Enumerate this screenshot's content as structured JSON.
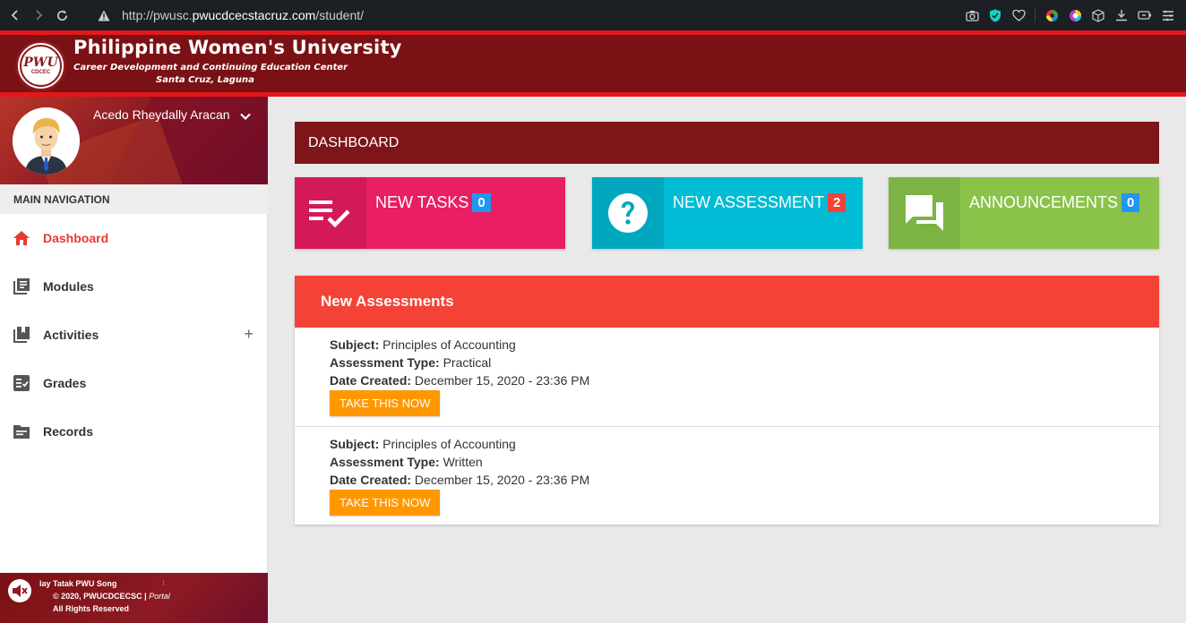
{
  "browser": {
    "url_prefix": "http://pwusc.",
    "url_host": "pwucdcecstacruz.com",
    "url_path": "/student/"
  },
  "header": {
    "logo_mark": "PWU",
    "logo_sub": "CDCEC",
    "university_name": "Philippine Women's University",
    "subtitle": "Career Development and Continuing Education Center",
    "location": "Santa Cruz, Laguna"
  },
  "sidebar": {
    "user_name": "Acedo Rheydally Aracan",
    "nav_header": "MAIN NAVIGATION",
    "items": [
      {
        "label": "Dashboard",
        "icon": "home-icon",
        "active": true
      },
      {
        "label": "Modules",
        "icon": "library-icon"
      },
      {
        "label": "Activities",
        "icon": "book-icon",
        "expand": "+"
      },
      {
        "label": "Grades",
        "icon": "checklist-icon"
      },
      {
        "label": "Records",
        "icon": "folder-icon"
      }
    ],
    "footer": {
      "song": "lay Tatak PWU Song",
      "separator": "⁝",
      "copyright": "© 2020, PWUCDCECSC | ",
      "portal": "Portal",
      "rights": "All Rights Reserved"
    }
  },
  "main": {
    "dashboard_title": "DASHBOARD",
    "info_boxes": [
      {
        "label": "NEW TASKS",
        "count": "0",
        "color": "#e91e63",
        "icon": "task-list-icon"
      },
      {
        "label": "NEW ASSESSMENT",
        "count": "2",
        "color": "#00bcd4",
        "icon": "question-icon"
      },
      {
        "label": "ANNOUNCEMENTS",
        "count": "0",
        "color": "#8bc34a",
        "icon": "forum-icon"
      }
    ],
    "assessments_title": "New Assessments",
    "field_labels": {
      "subject": "Subject:",
      "type": "Assessment Type:",
      "date": "Date Created:"
    },
    "assessments": [
      {
        "subject": "Principles of Accounting",
        "type": "Practical",
        "date": "December 15, 2020 - 23:36 PM",
        "button": "TAKE THIS NOW"
      },
      {
        "subject": "Principles of Accounting",
        "type": "Written",
        "date": "December 15, 2020 - 23:36 PM",
        "button": "TAKE THIS NOW"
      }
    ]
  },
  "colors": {
    "header_bg": "#7a1114",
    "header_accent": "#e4171b",
    "active_nav": "#e53935",
    "card_header": "#f44336",
    "button": "#ff9800"
  }
}
